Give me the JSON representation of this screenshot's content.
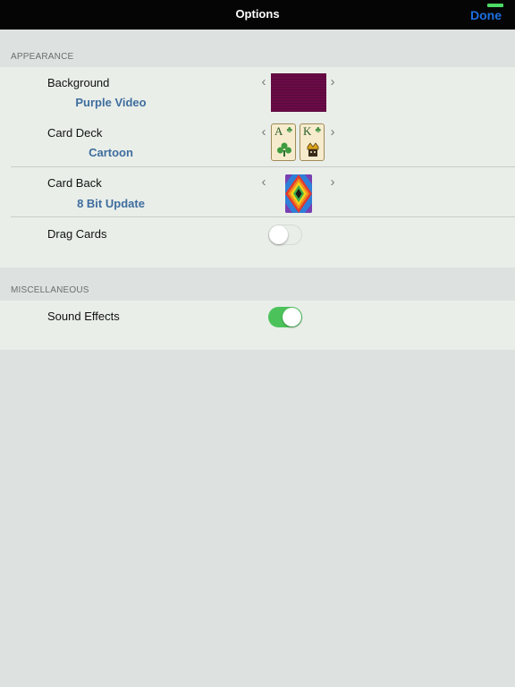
{
  "navbar": {
    "title": "Options",
    "done_label": "Done"
  },
  "sections": {
    "appearance": {
      "header": "APPEARANCE",
      "background": {
        "label": "Background",
        "value": "Purple Video"
      },
      "card_deck": {
        "label": "Card Deck",
        "value": "Cartoon",
        "preview_cards": [
          "A",
          "K"
        ]
      },
      "card_back": {
        "label": "Card Back",
        "value": "8 Bit Update"
      },
      "drag_cards": {
        "label": "Drag Cards",
        "enabled": false
      }
    },
    "miscellaneous": {
      "header": "MISCELLANEOUS",
      "sound_effects": {
        "label": "Sound Effects",
        "enabled": true
      }
    }
  },
  "icons": {
    "prev": "chevron-left-icon",
    "next": "chevron-right-icon"
  },
  "chevrons": {
    "left": "‹",
    "right": "›"
  },
  "colors": {
    "accent": "#1e6ee0",
    "value_text": "#3f6d9e",
    "toggle_on": "#4cc35a",
    "background_swatch": "#6a0b47"
  }
}
